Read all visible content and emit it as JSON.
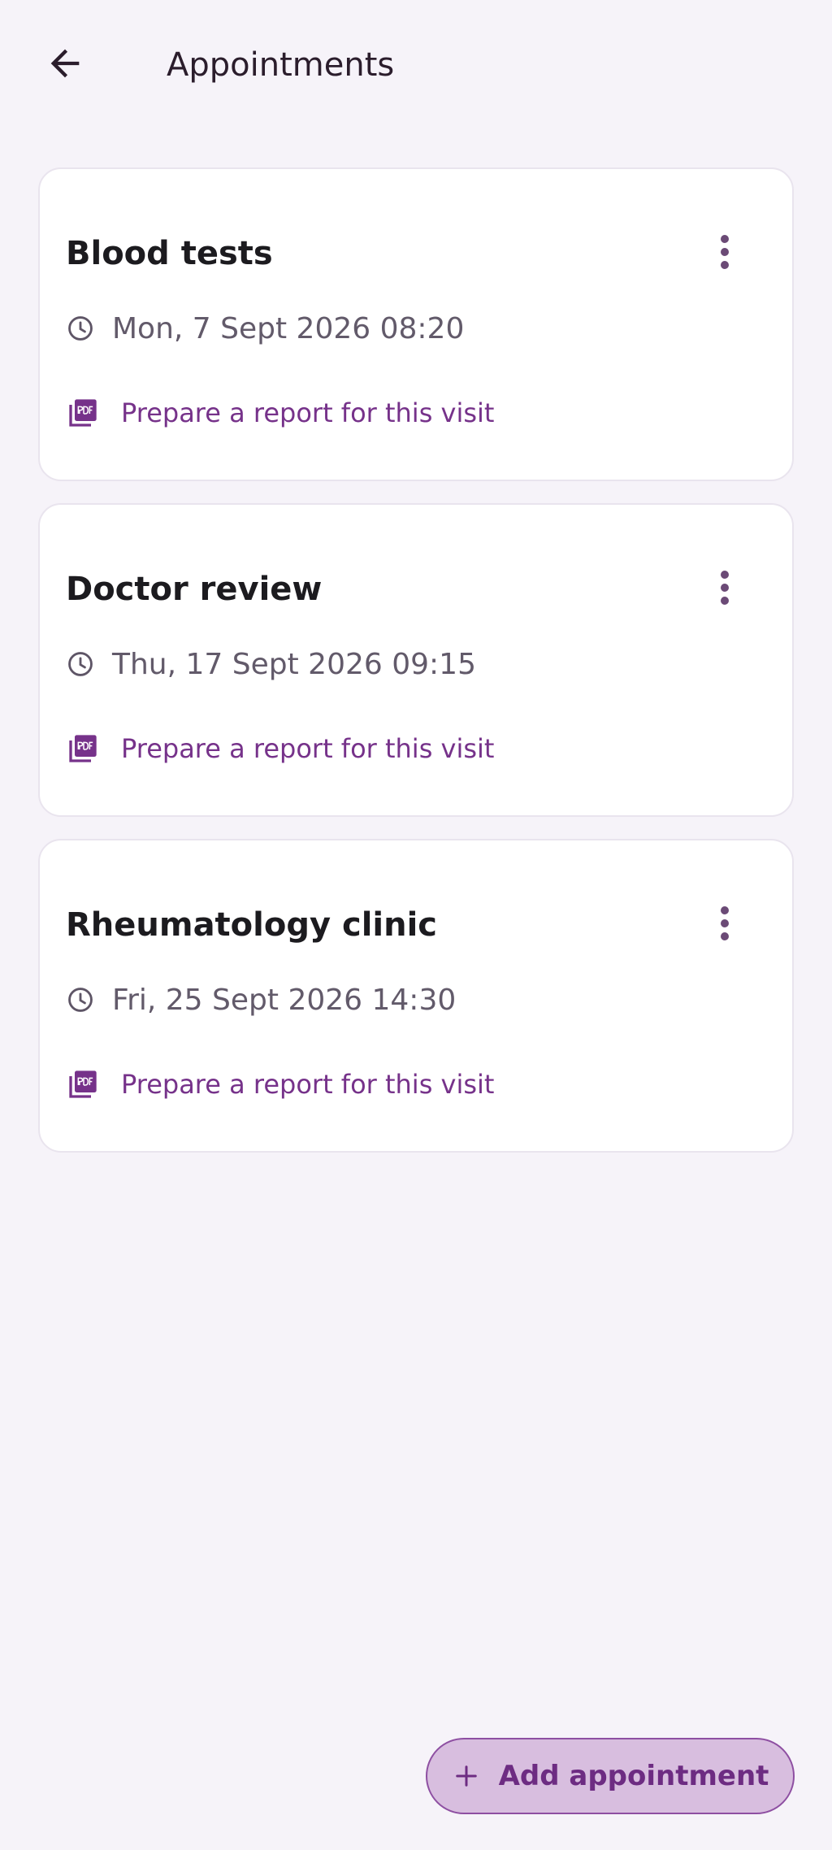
{
  "header": {
    "title": "Appointments",
    "back_icon": "arrow-back-icon"
  },
  "appointments": [
    {
      "title": "Blood tests",
      "datetime": "Mon, 7 Sept 2026 08:20",
      "report_link": "Prepare a report for this visit"
    },
    {
      "title": "Doctor review",
      "datetime": "Thu, 17 Sept 2026 09:15",
      "report_link": "Prepare a report for this visit"
    },
    {
      "title": "Rheumatology clinic",
      "datetime": "Fri, 25 Sept 2026 14:30",
      "report_link": "Prepare a report for this visit"
    }
  ],
  "fab": {
    "label": "Add appointment",
    "icon": "plus-icon"
  },
  "colors": {
    "background": "#f6f3f9",
    "card": "#ffffff",
    "accent": "#76328a",
    "fab_fill": "#d8bedf",
    "fab_border": "#8e4fa2",
    "secondary_text": "#625a6a"
  }
}
